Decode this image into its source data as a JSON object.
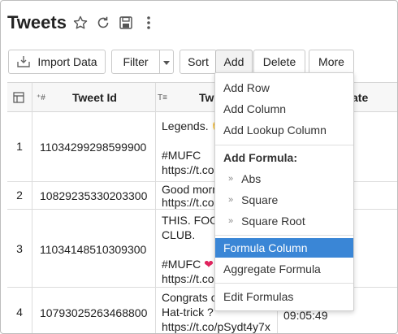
{
  "header": {
    "title": "Tweets"
  },
  "toolbar": {
    "import_label": "Import Data",
    "filter_label": "Filter",
    "sort_label": "Sort",
    "add_label": "Add",
    "delete_label": "Delete",
    "more_label": "More"
  },
  "table": {
    "columns": {
      "tweet_id": "Tweet Id",
      "tweet": "Tw",
      "date": "ate"
    },
    "rows": [
      {
        "num": "1",
        "id": "11034299298599900",
        "text": [
          "Legends. ✊",
          "",
          "#MUFC",
          "https://t.co"
        ],
        "date": ""
      },
      {
        "num": "2",
        "id": "10829235330203300",
        "text": [
          "Good morn",
          "https://t.co"
        ],
        "date": ""
      },
      {
        "num": "3",
        "id": "11034148510309300",
        "text": [
          "THIS. FOO",
          "CLUB.",
          "",
          "#MUFC ❤",
          "https://t.co"
        ],
        "date": ""
      },
      {
        "num": "4",
        "id": "10793025263468800",
        "text": [
          "Congrats o",
          "Hat-trick ?",
          "https://t.co/pSydt4y7x"
        ],
        "date": "09:05:49"
      }
    ]
  },
  "menu": {
    "add_row": "Add Row",
    "add_column": "Add Column",
    "add_lookup_column": "Add Lookup Column",
    "add_formula_heading": "Add Formula:",
    "abs": "Abs",
    "square": "Square",
    "square_root": "Square Root",
    "formula_column": "Formula Column",
    "aggregate_formula": "Aggregate Formula",
    "edit_formulas": "Edit Formulas"
  },
  "colors": {
    "selected_bg": "#3a86d6",
    "heart": "#e0245e"
  }
}
